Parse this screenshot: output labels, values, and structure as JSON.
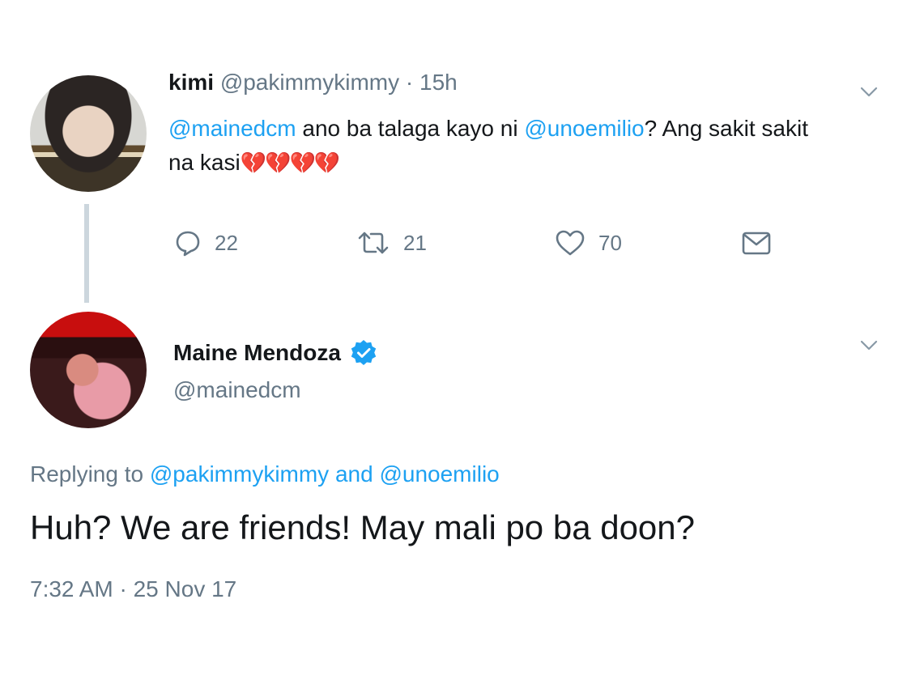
{
  "parent_tweet": {
    "avatar_alt": "kimi avatar",
    "name": "kimi",
    "handle": "@pakimmykimmy",
    "separator": "·",
    "time_ago": "15h",
    "text": {
      "mention_1": "@mainedcm",
      "part_1": " ano ba talaga kayo ni ",
      "mention_2": "@unoemilio",
      "part_2": "? Ang sakit sakit na kasi",
      "emoji": "💔💔💔💔"
    },
    "actions": {
      "reply_count": "22",
      "retweet_count": "21",
      "like_count": "70",
      "reply_icon": "reply-icon",
      "retweet_icon": "retweet-icon",
      "like_icon": "heart-icon",
      "dm_icon": "envelope-icon"
    }
  },
  "reply_tweet": {
    "name": "Maine Mendoza",
    "verified": true,
    "handle": "@mainedcm",
    "replying_prefix": "Replying to ",
    "replying_to_1": "@pakimmykimmy",
    "replying_and": " and ",
    "replying_to_2": "@unoemilio",
    "text": "Huh? We are friends! May mali po ba doon?",
    "timestamp": "7:32 AM · 25 Nov 17"
  },
  "colors": {
    "link": "#1da1f2",
    "secondary_text": "#657786",
    "primary_text": "#14171a",
    "heart": "#e0245e",
    "verified": "#1da1f2",
    "thread_line": "#ccd6dd"
  }
}
